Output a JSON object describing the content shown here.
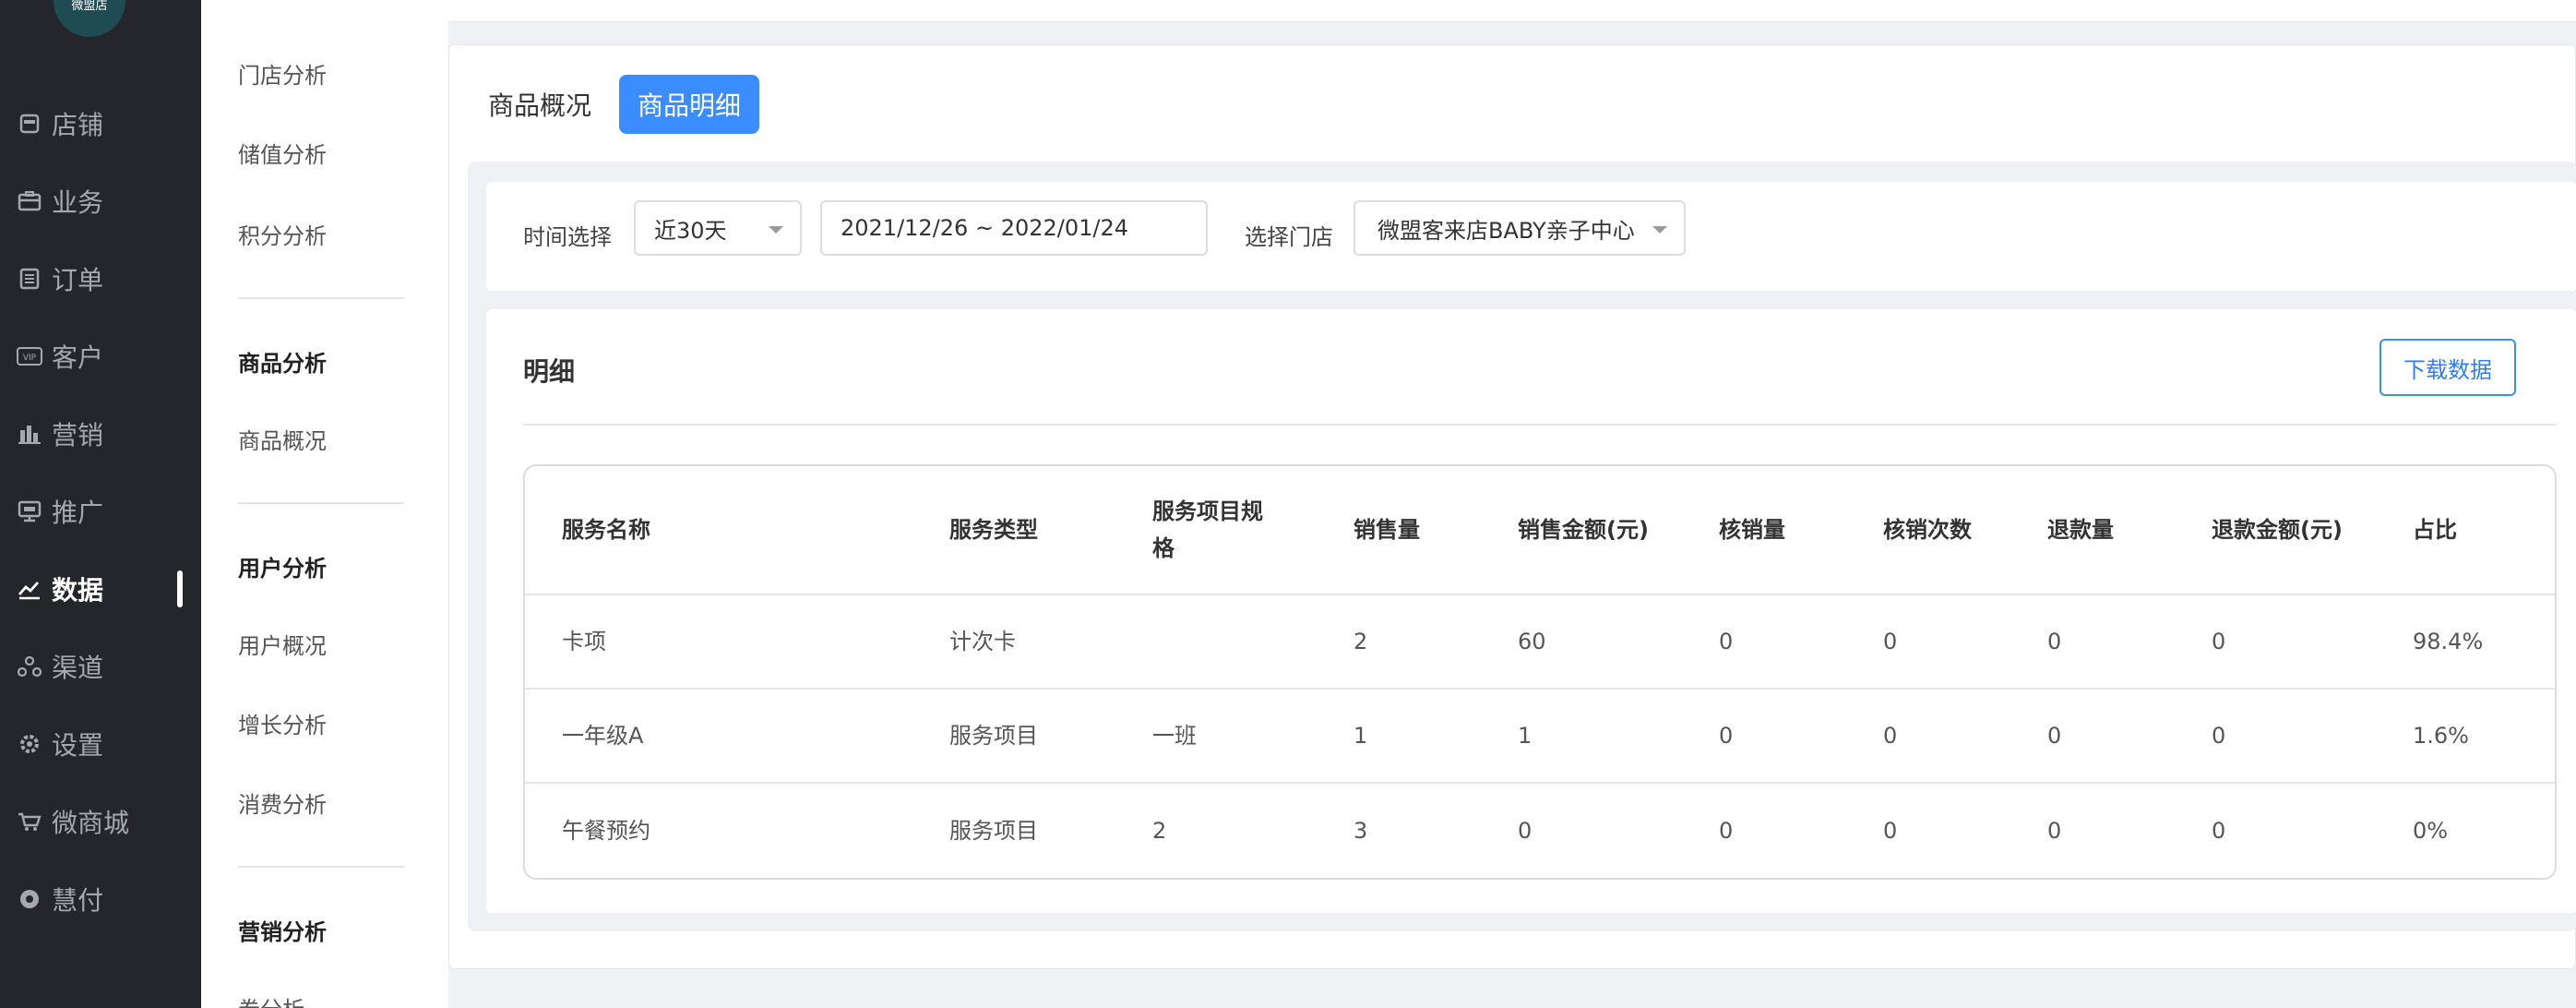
{
  "logo_text": "微盟店",
  "nav": [
    {
      "label": "店铺",
      "icon": "store-icon"
    },
    {
      "label": "业务",
      "icon": "briefcase-icon"
    },
    {
      "label": "订单",
      "icon": "order-list-icon"
    },
    {
      "label": "客户",
      "icon": "vip-card-icon"
    },
    {
      "label": "营销",
      "icon": "bar-chart-icon"
    },
    {
      "label": "推广",
      "icon": "promotion-screen-icon"
    },
    {
      "label": "数据",
      "icon": "line-chart-icon"
    },
    {
      "label": "渠道",
      "icon": "channel-icon"
    },
    {
      "label": "设置",
      "icon": "gear-icon"
    },
    {
      "label": "微商城",
      "icon": "shopping-cart-icon"
    },
    {
      "label": "慧付",
      "icon": "payment-coin-icon"
    }
  ],
  "nav_active": "数据",
  "subnav": {
    "items_top": [
      "门店分析",
      "储值分析",
      "积分分析"
    ],
    "goods_head": "商品分析",
    "goods_items": [
      "商品概况"
    ],
    "user_head": "用户分析",
    "user_items": [
      "用户概况",
      "增长分析",
      "消费分析"
    ],
    "marketing_head": "营销分析",
    "marketing_items": [
      "券分析"
    ]
  },
  "tabs": {
    "overview": "商品概况",
    "detail": "商品明细"
  },
  "filter": {
    "time_label": "时间选择",
    "time_value": "近30天",
    "date_range": "2021/12/26 ~ 2022/01/24",
    "store_label": "选择门店",
    "store_value": "微盟客来店BABY亲子中心"
  },
  "detail": {
    "title": "明细",
    "download_label": "下载数据"
  },
  "table": {
    "headers": [
      "服务名称",
      "服务类型",
      "服务项目规格",
      "销售量",
      "销售金额(元)",
      "核销量",
      "核销次数",
      "退款量",
      "退款金额(元)",
      "占比"
    ],
    "rows": [
      [
        "卡项",
        "计次卡",
        "",
        "2",
        "60",
        "0",
        "0",
        "0",
        "0",
        "98.4%"
      ],
      [
        "一年级A",
        "服务项目",
        "一班",
        "1",
        "1",
        "0",
        "0",
        "0",
        "0",
        "1.6%"
      ],
      [
        "午餐预约",
        "服务项目",
        "2",
        "3",
        "0",
        "0",
        "0",
        "0",
        "0",
        "0%"
      ]
    ]
  },
  "colors": {
    "accent": "#3b8cff",
    "nav_bg": "#25262b",
    "page_bg": "#f0f1f5"
  }
}
